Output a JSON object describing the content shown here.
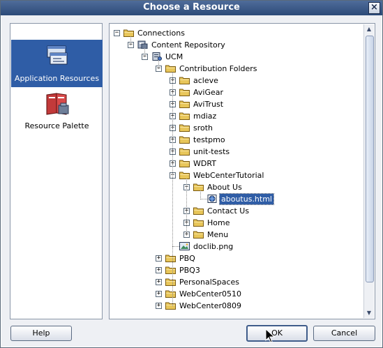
{
  "window": {
    "title": "Choose a Resource",
    "close_glyph": "×"
  },
  "leftnav": {
    "items": [
      {
        "label": "Application Resources",
        "icon": "application-resources-icon",
        "selected": true
      },
      {
        "label": "Resource Palette",
        "icon": "resource-palette-icon",
        "selected": false
      }
    ]
  },
  "tree": {
    "nodes": [
      {
        "label": "Connections",
        "icon": "folder",
        "expander": "-"
      },
      {
        "label": "Content Repository",
        "icon": "repository",
        "expander": "-"
      },
      {
        "label": "UCM",
        "icon": "server",
        "expander": "-"
      },
      {
        "label": "Contribution Folders",
        "icon": "folder",
        "expander": "-"
      },
      {
        "label": "acleve",
        "icon": "folder",
        "expander": "+"
      },
      {
        "label": "AviGear",
        "icon": "folder",
        "expander": "+"
      },
      {
        "label": "AviTrust",
        "icon": "folder",
        "expander": "+"
      },
      {
        "label": "mdiaz",
        "icon": "folder",
        "expander": "+"
      },
      {
        "label": "sroth",
        "icon": "folder",
        "expander": "+"
      },
      {
        "label": "testpmo",
        "icon": "folder",
        "expander": "+"
      },
      {
        "label": "unit-tests",
        "icon": "folder",
        "expander": "+"
      },
      {
        "label": "WDRT",
        "icon": "folder",
        "expander": "+"
      },
      {
        "label": "WebCenterTutorial",
        "icon": "folder",
        "expander": "-"
      },
      {
        "label": "About Us",
        "icon": "folder",
        "expander": "-"
      },
      {
        "label": "aboutus.html",
        "icon": "html-file",
        "expander": "",
        "selected": true
      },
      {
        "label": "Contact Us",
        "icon": "folder",
        "expander": "+"
      },
      {
        "label": "Home",
        "icon": "folder",
        "expander": "+"
      },
      {
        "label": "Menu",
        "icon": "folder",
        "expander": "+"
      },
      {
        "label": "doclib.png",
        "icon": "image-file",
        "expander": ""
      },
      {
        "label": "PBQ",
        "icon": "folder",
        "expander": "+"
      },
      {
        "label": "PBQ3",
        "icon": "folder",
        "expander": "+"
      },
      {
        "label": "PersonalSpaces",
        "icon": "folder",
        "expander": "+"
      },
      {
        "label": "WebCenter0510",
        "icon": "folder",
        "expander": "+"
      },
      {
        "label": "WebCenter0809",
        "icon": "folder",
        "expander": "+"
      }
    ]
  },
  "buttons": {
    "help": "Help",
    "ok": "OK",
    "cancel": "Cancel"
  },
  "colors": {
    "titlebar": "#2c4a78",
    "selection": "#2f5da6",
    "folder": "#e8c65a",
    "background": "#eef0f4"
  }
}
